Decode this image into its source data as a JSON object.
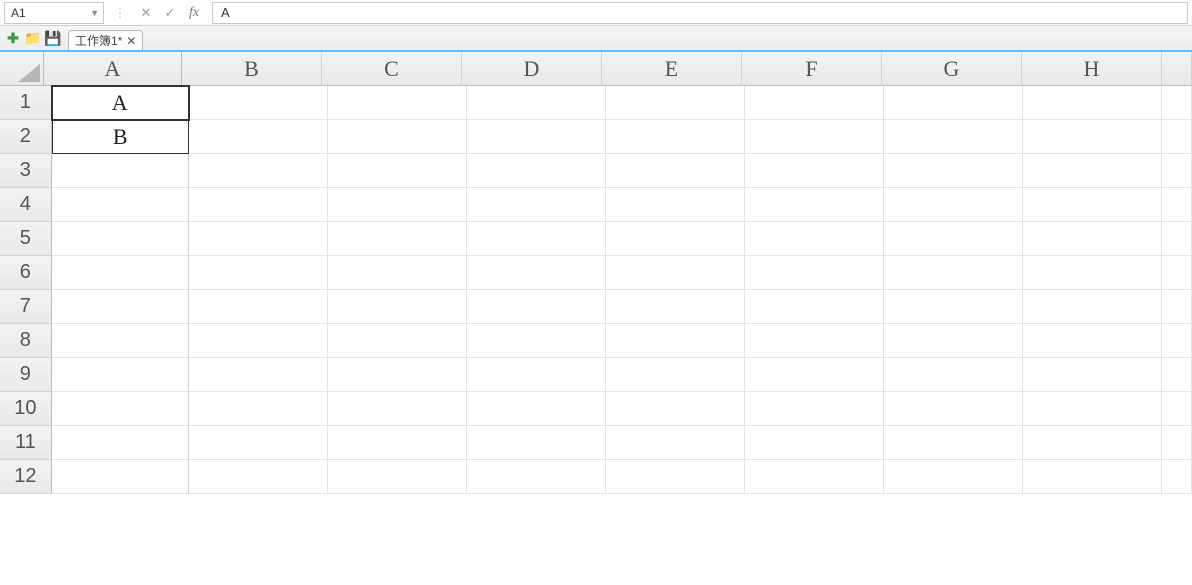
{
  "formula_bar": {
    "name_box": "A1",
    "cancel_icon": "✕",
    "confirm_icon": "✓",
    "fx_label": "fx",
    "value": "A"
  },
  "tab_strip": {
    "workbook_tab": "工作簿1*",
    "close_icon": "✕"
  },
  "columns": [
    "A",
    "B",
    "C",
    "D",
    "E",
    "F",
    "G",
    "H"
  ],
  "rows": [
    "1",
    "2",
    "3",
    "4",
    "5",
    "6",
    "7",
    "8",
    "9",
    "10",
    "11",
    "12"
  ],
  "cells": {
    "A1": "A",
    "A2": "B"
  },
  "active_cell": "A1",
  "selection_range": [
    "A1",
    "A2"
  ]
}
